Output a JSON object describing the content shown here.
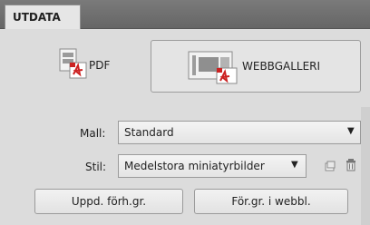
{
  "panel": {
    "tab_title": "UTDATA"
  },
  "output": {
    "pdf_label": "PDF",
    "web_label": "WEBBGALLERI"
  },
  "template": {
    "label": "Mall:",
    "value": "Standard"
  },
  "style": {
    "label": "Stil:",
    "value": "Medelstora miniatyrbilder"
  },
  "buttons": {
    "refresh_preview": "Uppd. förh.gr.",
    "preview_in_browser": "För.gr. i webbl."
  },
  "icons": {
    "pdf": "pdf-document-icon",
    "web": "web-gallery-icon",
    "new_style": "new-style-icon",
    "delete_style": "trash-icon",
    "dropdown": "chevron-down-icon"
  },
  "colors": {
    "pdf_accent": "#cc2222",
    "tab_bar": "#6e6e6e",
    "panel_bg": "#dcdcdc"
  }
}
